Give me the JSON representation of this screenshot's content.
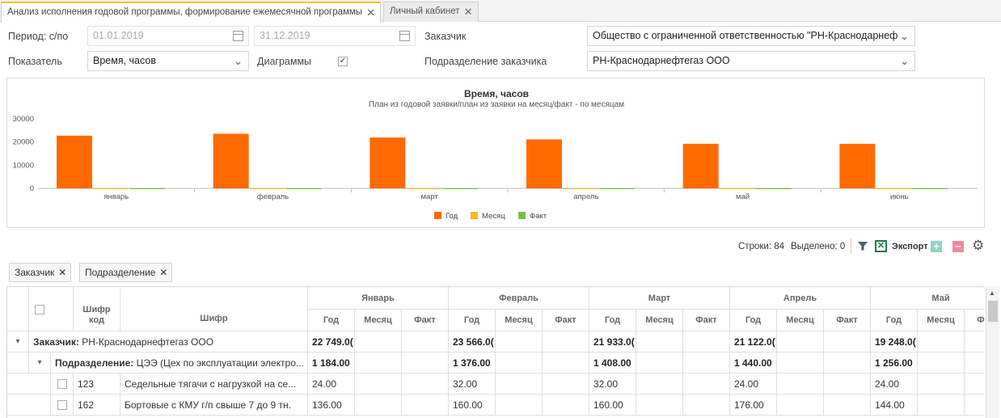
{
  "tabs": [
    {
      "label": "Анализ исполнения годовой программы, формирование ежемесячной программы"
    },
    {
      "label": "Личный кабинет"
    }
  ],
  "filters": {
    "period_label": "Период: с/по",
    "date_from": "01.01.2019",
    "date_to": "31.12.2019",
    "customer_label": "Заказчик",
    "customer_value": "Общество с ограниченной ответственностью \"РН-Краснодарнеф",
    "indicator_label": "Показатель",
    "indicator_value": "Время, часов",
    "charts_label": "Диаграммы",
    "charts_checked": true,
    "subdivision_label": "Подразделение заказчика",
    "subdivision_value": "РН-Краснодарнефтегаз ООО"
  },
  "chart_data": {
    "type": "bar",
    "title": "Время, часов",
    "subtitle": "План из годовой заявки/план из заявки на месяц/факт - по месяцам",
    "categories": [
      "январь",
      "февраль",
      "март",
      "апрель",
      "май",
      "июнь"
    ],
    "series": [
      {
        "name": "Год",
        "color": "#ff6a00",
        "values": [
          22749,
          23566,
          21933,
          21122,
          19248,
          19248
        ]
      },
      {
        "name": "Месяц",
        "color": "#f5b921",
        "values": [
          0,
          0,
          0,
          0,
          0,
          0
        ]
      },
      {
        "name": "Факт",
        "color": "#77c043",
        "values": [
          0,
          0,
          0,
          0,
          0,
          0
        ]
      }
    ],
    "yticks": [
      "30000",
      "20000",
      "10000",
      "0"
    ],
    "ylim": [
      0,
      30000
    ],
    "legend": "bottom"
  },
  "toolbar": {
    "rows_text": "Строки: 84",
    "selected_text": "Выделено: 0",
    "export_label": "Экспорт"
  },
  "grouping": [
    {
      "label": "Заказчик"
    },
    {
      "label": "Подразделение"
    }
  ],
  "grid": {
    "col_code": "Шифр код",
    "col_name": "Шифр",
    "months": [
      "Январь",
      "Февраль",
      "Март",
      "Апрель",
      "Май"
    ],
    "sub_cols": [
      "Год",
      "Месяц",
      "Факт"
    ],
    "group1": {
      "prefix": "Заказчик:",
      "value": "РН-Краснодарнефтегаз ООО",
      "totals": [
        "22 749.0(",
        "23 566.0(",
        "21 933.0(",
        "21 122.0(",
        "19 248.0("
      ]
    },
    "group2": {
      "prefix": "Подразделение:",
      "value": "ЦЭЭ (Цех по эксплуатации электро...",
      "totals": [
        "1 184.00",
        "1 376.00",
        "1 408.00",
        "1 440.00",
        "1 256.00"
      ]
    },
    "rows": [
      {
        "code": "123",
        "name": "Седельные тягачи с нагрузкой на се...",
        "vals": [
          "24.00",
          "32.00",
          "32.00",
          "24.00",
          "24.00"
        ]
      },
      {
        "code": "162",
        "name": "Бортовые с КМУ г/п свыше 7 до 9 тн.",
        "vals": [
          "136.00",
          "160.00",
          "160.00",
          "176.00",
          "144.00"
        ]
      }
    ]
  },
  "colors": {
    "accent": "#f0c419",
    "bar": "#ff6a00"
  }
}
